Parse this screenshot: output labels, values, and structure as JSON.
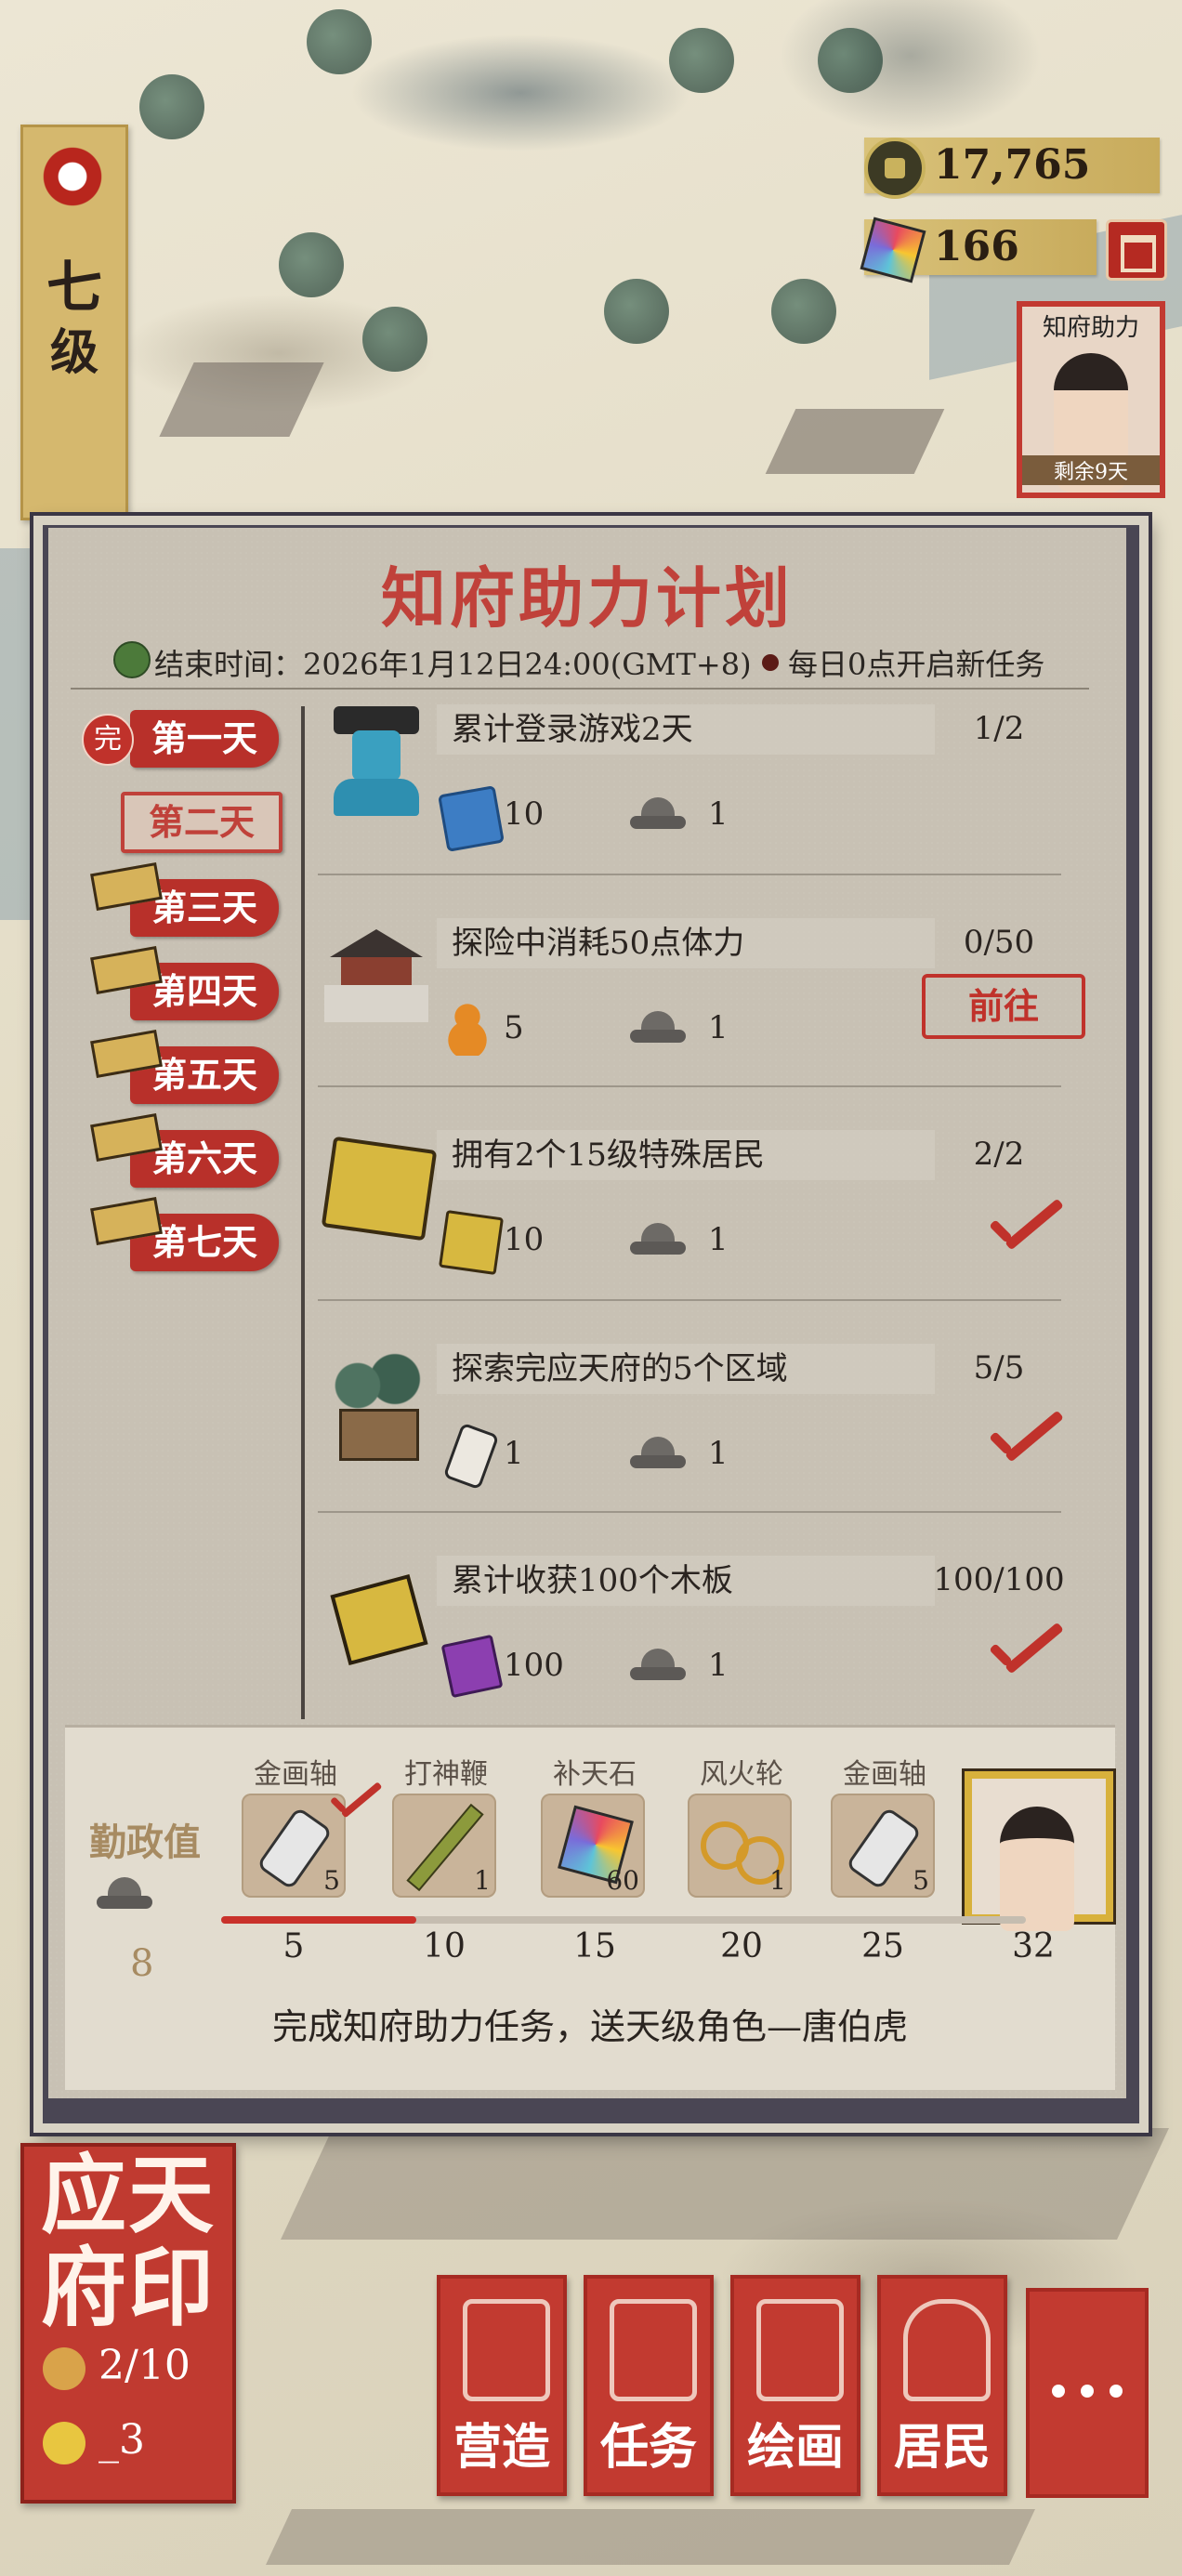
{
  "hud": {
    "level": [
      "七",
      "级"
    ],
    "coins": "17,765",
    "gems": "166"
  },
  "side_card": {
    "title": "知府助力",
    "badge": "剩余9天"
  },
  "panel": {
    "title": "知府助力计划",
    "end_time": "结束时间：2026年1月12日24:00(GMT+8)",
    "daily_note": "每日0点开启新任务",
    "done_mark": "完",
    "goto_label": "前往"
  },
  "days": [
    "第一天",
    "第二天",
    "第三天",
    "第四天",
    "第五天",
    "第六天",
    "第七天"
  ],
  "tasks": [
    {
      "title": "累计登录游戏2天",
      "progress": "1/2",
      "reward_icon": "blue-ticket-icon",
      "reward_amount": "10",
      "points": "1",
      "state": "in-progress"
    },
    {
      "title": "探险中消耗50点体力",
      "progress": "0/50",
      "reward_icon": "gourd-icon",
      "reward_amount": "5",
      "points": "1",
      "state": "go"
    },
    {
      "title": "拥有2个15级特殊居民",
      "progress": "2/2",
      "reward_icon": "book-stack-icon",
      "reward_amount": "10",
      "points": "1",
      "state": "done"
    },
    {
      "title": "探索完应天府的5个区域",
      "progress": "5/5",
      "reward_icon": "scroll-icon",
      "reward_amount": "1",
      "points": "1",
      "state": "done"
    },
    {
      "title": "累计收获100个木板",
      "progress": "100/100",
      "reward_icon": "purple-cloth-icon",
      "reward_amount": "100",
      "points": "1",
      "state": "done"
    }
  ],
  "diligence": {
    "label": "勤政值",
    "value": "8",
    "current_progress": 8,
    "milestones": [
      "5",
      "10",
      "15",
      "20",
      "25",
      "32"
    ],
    "rewards": [
      {
        "name": "金画轴",
        "count": "5",
        "icon": "gold-scroll-icon",
        "claimed": true
      },
      {
        "name": "打神鞭",
        "count": "1",
        "icon": "whip-icon",
        "claimed": false
      },
      {
        "name": "补天石",
        "count": "60",
        "icon": "rainbow-stone-icon",
        "claimed": false
      },
      {
        "name": "风火轮",
        "count": "1",
        "icon": "fire-wheel-icon",
        "claimed": false
      },
      {
        "name": "金画轴",
        "count": "5",
        "icon": "gold-scroll-icon",
        "claimed": false
      }
    ],
    "promo": "完成知府助力任务，送天级角色—唐伯虎"
  },
  "seal": {
    "chars": "应天府印",
    "row1": "2/10",
    "row2": "_3"
  },
  "nav": [
    "营造",
    "任务",
    "绘画",
    "居民"
  ]
}
